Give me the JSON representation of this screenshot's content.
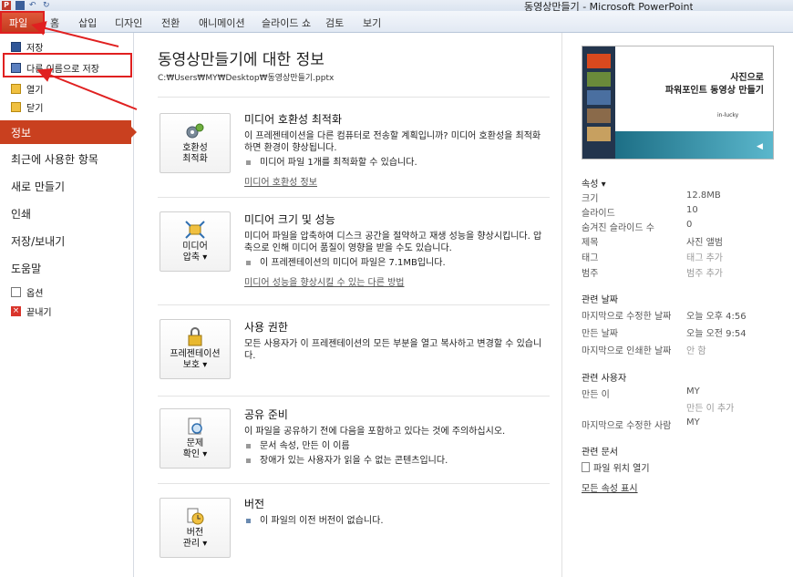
{
  "window": {
    "title": "동영상만들기 - Microsoft PowerPoint"
  },
  "ribbon": {
    "file_tab": "파일",
    "tabs": [
      "홈",
      "삽입",
      "디자인",
      "전환",
      "애니메이션",
      "슬라이드 쇼",
      "검토",
      "보기"
    ]
  },
  "nav": {
    "save": "저장",
    "save_as": "다른 이름으로 저장",
    "open": "열기",
    "close": "닫기",
    "info": "정보",
    "recent": "최근에 사용한 항목",
    "new": "새로 만들기",
    "print": "인쇄",
    "save_send": "저장/보내기",
    "help": "도움말",
    "options": "옵션",
    "exit": "끝내기"
  },
  "main": {
    "title": "동영상만들기에 대한 정보",
    "path": "C:₩Users₩MY₩Desktop₩동영상만들기.pptx",
    "sections": [
      {
        "button": [
          "호환성",
          "최적화"
        ],
        "title": "미디어 호환성 최적화",
        "desc": "이 프레젠테이션을 다른 컴퓨터로 전송할 계획입니까? 미디어 호환성을 최적화하면 환경이 향상됩니다.",
        "bullet": "미디어 파일 1개를 최적화할 수 있습니다.",
        "link": "미디어 호환성 정보"
      },
      {
        "button": [
          "미디어",
          "압축 ▾"
        ],
        "title": "미디어 크기 및 성능",
        "desc": "미디어 파일을 압축하여 디스크 공간을 절약하고 재생 성능을 향상시킵니다. 압축으로 인해 미디어 품질이 영향을 받을 수도 있습니다.",
        "bullet": "이 프레젠테이션의 미디어 파일은 7.1MB입니다.",
        "link": "미디어 성능을 향상시킬 수 있는 다른 방법"
      },
      {
        "button": [
          "프레젠테이션",
          "보호 ▾"
        ],
        "title": "사용 권한",
        "desc": "모든 사용자가 이 프레젠테이션의 모든 부분을 열고 복사하고 변경할 수 있습니다."
      },
      {
        "button": [
          "문제",
          "확인 ▾"
        ],
        "title": "공유 준비",
        "desc": "이 파일을 공유하기 전에 다음을 포함하고 있다는 것에 주의하십시오.",
        "bullets": [
          "문서 속성, 만든 이 이름",
          "장애가 있는 사용자가 읽을 수 없는 콘텐츠입니다."
        ]
      },
      {
        "button": [
          "버전",
          "관리 ▾"
        ],
        "title": "버전",
        "bullet": "이 파일의 이전 버전이 없습니다."
      }
    ]
  },
  "thumbnail": {
    "title_line1": "사진으로",
    "title_line2": "파워포인트 동영상 만들기",
    "subtitle": "in-lucky"
  },
  "props": {
    "heading": "속성 ▾",
    "rows": [
      {
        "k": "크기",
        "v": "12.8MB"
      },
      {
        "k": "슬라이드",
        "v": "10"
      },
      {
        "k": "숨겨진 슬라이드 수",
        "v": "0"
      },
      {
        "k": "제목",
        "v": "사진 앨범"
      },
      {
        "k": "태그",
        "v": "태그 추가"
      },
      {
        "k": "범주",
        "v": "범주 추가"
      }
    ],
    "dates_heading": "관련 날짜",
    "dates": [
      {
        "k": "마지막으로 수정한 날짜",
        "v": "오늘 오후 4:56"
      },
      {
        "k": "만든 날짜",
        "v": "오늘 오전 9:54"
      },
      {
        "k": "마지막으로 인쇄한 날짜",
        "v": "안 함"
      }
    ],
    "people_heading": "관련 사용자",
    "author_k": "만든 이",
    "author_v": "MY",
    "add_author": "만든 이 추가",
    "modified_by_k": "마지막으로 수정한 사람",
    "modified_by_v": "MY",
    "docs_heading": "관련 문서",
    "open_location": "파일 위치 열기",
    "all_props": "모든 속성 표시"
  }
}
